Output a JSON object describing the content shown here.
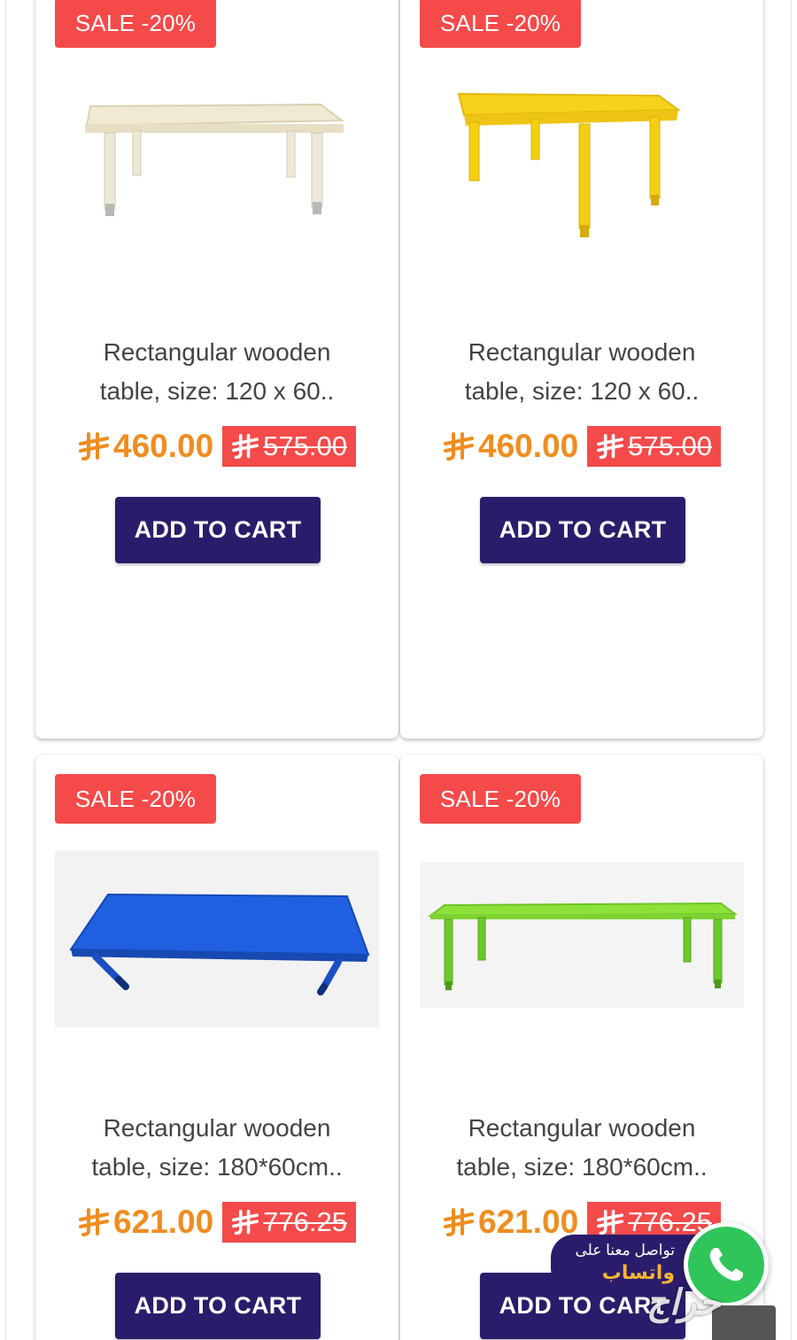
{
  "products": [
    {
      "sale_badge": "SALE -20%",
      "title_line1": "Rectangular wooden",
      "title_line2": "table, size: 120 x 60..",
      "price": "460.00",
      "old_price": "575.00",
      "cart_label": "ADD TO CART",
      "table_color": "#f0ead4",
      "leg_color": "#ece9d8"
    },
    {
      "sale_badge": "SALE -20%",
      "title_line1": "Rectangular wooden",
      "title_line2": "table, size: 120 x 60..",
      "price": "460.00",
      "old_price": "575.00",
      "cart_label": "ADD TO CART",
      "table_color": "#f7d21a",
      "leg_color": "#f3cf12"
    },
    {
      "sale_badge": "SALE -20%",
      "title_line1": "Rectangular wooden",
      "title_line2": "table, size: 180*60cm..",
      "price": "621.00",
      "old_price": "776.25",
      "cart_label": "ADD TO CART",
      "table_color": "#1f5fe0",
      "leg_color": "#1a4fc4"
    },
    {
      "sale_badge": "SALE -20%",
      "title_line1": "Rectangular wooden",
      "title_line2": "table, size: 180*60cm..",
      "price": "621.00",
      "old_price": "776.25",
      "cart_label": "ADD TO CART",
      "table_color": "#8de23a",
      "leg_color": "#6cc92a"
    }
  ],
  "currency_icon": "saudi-riyal-icon",
  "whatsapp": {
    "line1": "تواصل معنا على",
    "line2": "واتساب",
    "icon": "whatsapp-icon"
  },
  "watermark_text": "حراج",
  "colors": {
    "sale_red": "#f44a4a",
    "price_orange": "#ef8d1f",
    "button_navy": "#2b1c6b",
    "whatsapp_green": "#2fc55a"
  }
}
